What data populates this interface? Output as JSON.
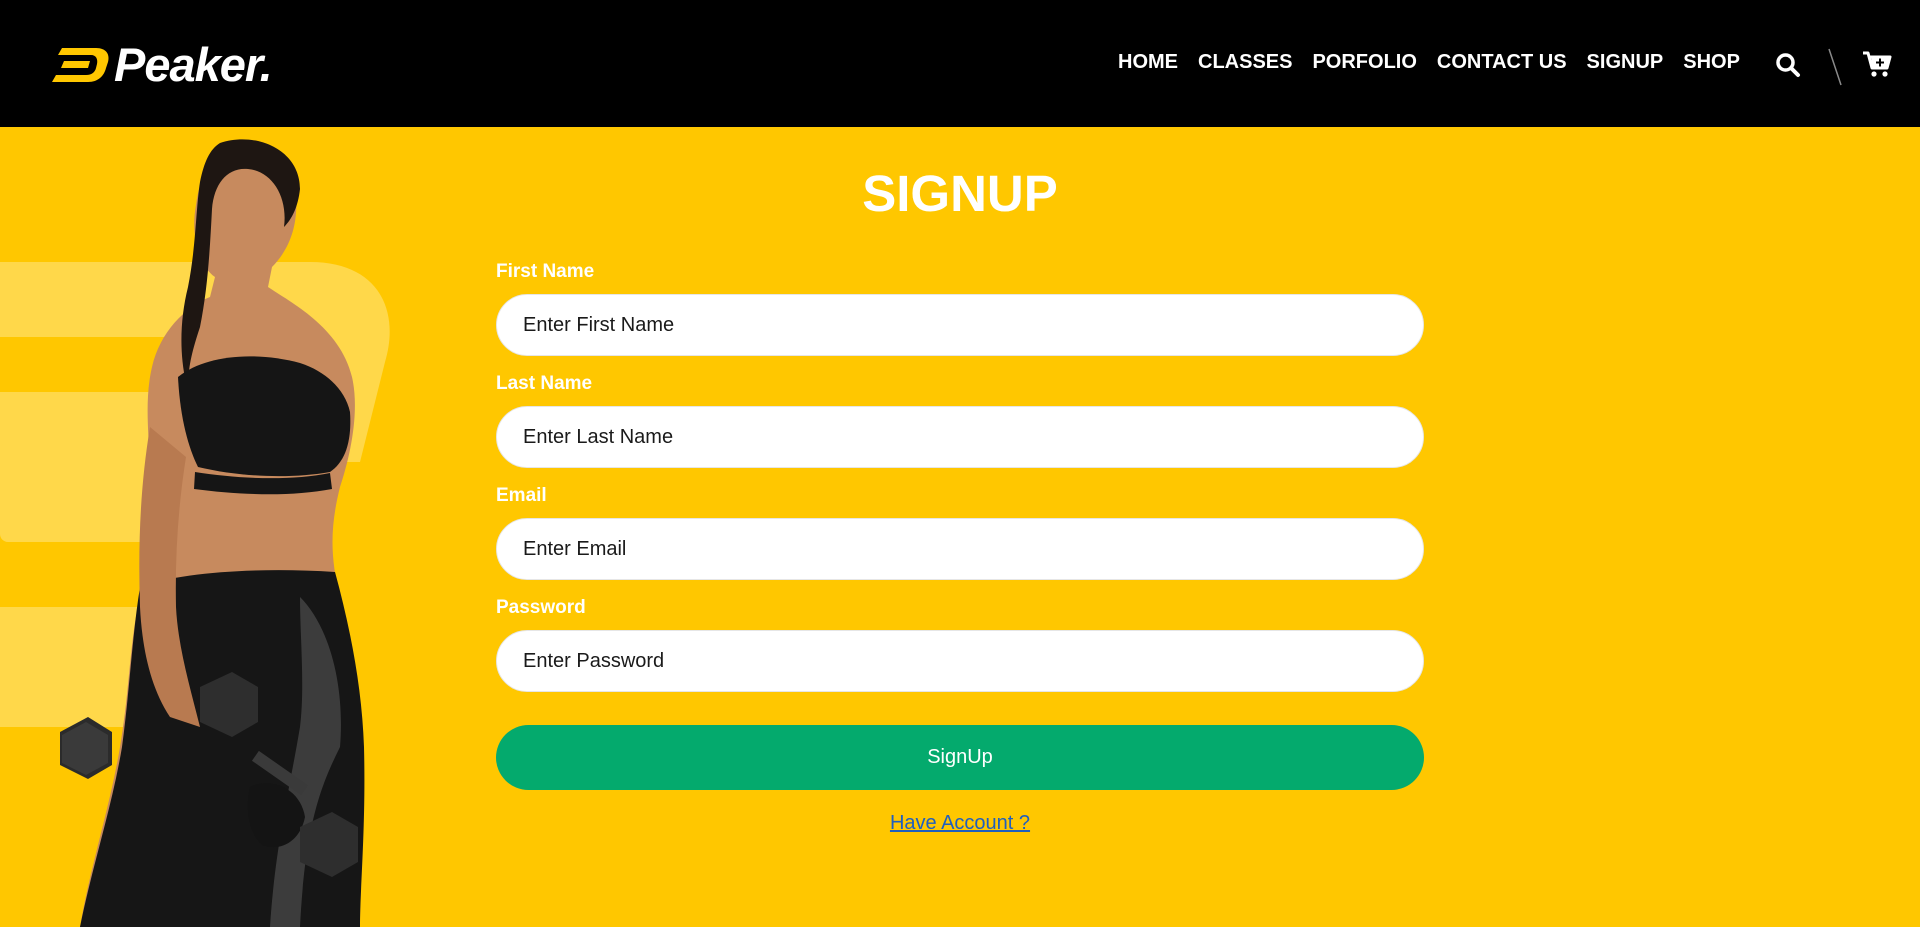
{
  "brand": {
    "name": "Peaker",
    "dot": ".",
    "accent": "#ffc700"
  },
  "nav": {
    "items": [
      {
        "label": "HOME"
      },
      {
        "label": "CLASSES"
      },
      {
        "label": "PORFOLIO"
      },
      {
        "label": "CONTACT US"
      },
      {
        "label": "SIGNUP"
      },
      {
        "label": "SHOP"
      }
    ],
    "icons": [
      "search-icon",
      "divider-icon",
      "cart-icon"
    ]
  },
  "page": {
    "title": "SIGNUP"
  },
  "form": {
    "first_name": {
      "label": "First Name",
      "placeholder": "Enter First Name"
    },
    "last_name": {
      "label": "Last Name",
      "placeholder": "Enter Last Name"
    },
    "email": {
      "label": "Email",
      "placeholder": "Enter Email"
    },
    "password": {
      "label": "Password",
      "placeholder": "Enter Password"
    },
    "submit_label": "SignUp",
    "login_link": "Have Account ?"
  },
  "colors": {
    "background": "#ffc700",
    "navbar": "#000000",
    "button": "#04aa6d",
    "link": "#1f5fbf"
  }
}
